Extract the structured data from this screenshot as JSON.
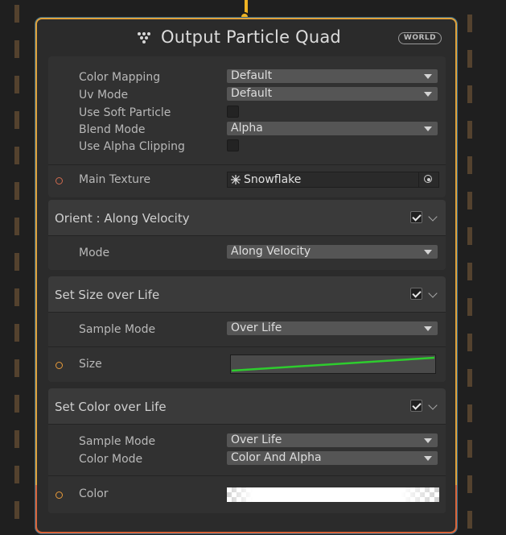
{
  "node": {
    "title": "Output Particle Quad",
    "space_badge": "WORLD"
  },
  "settings": {
    "color_mapping": {
      "label": "Color Mapping",
      "value": "Default"
    },
    "uv_mode": {
      "label": "Uv Mode",
      "value": "Default"
    },
    "use_soft_particle": {
      "label": "Use Soft Particle",
      "checked": false
    },
    "blend_mode": {
      "label": "Blend Mode",
      "value": "Alpha"
    },
    "use_alpha_clipping": {
      "label": "Use Alpha Clipping",
      "checked": false
    },
    "main_texture": {
      "label": "Main Texture",
      "value": "Snowflake",
      "icon": "snowflake-icon"
    }
  },
  "blocks": [
    {
      "title": "Orient : Along Velocity",
      "enabled": true,
      "rows": [
        {
          "label": "Mode",
          "value": "Along Velocity"
        }
      ]
    },
    {
      "title": "Set Size over Life",
      "enabled": true,
      "rows": [
        {
          "label": "Sample Mode",
          "value": "Over Life"
        }
      ],
      "input": {
        "label": "Size",
        "type": "curve",
        "curve_color": "#2ecc2e"
      }
    },
    {
      "title": "Set Color over Life",
      "enabled": true,
      "rows": [
        {
          "label": "Sample Mode",
          "value": "Over Life"
        },
        {
          "label": "Color Mode",
          "value": "Color And Alpha"
        }
      ],
      "input": {
        "label": "Color",
        "type": "gradient"
      }
    }
  ],
  "colors": {
    "node_border": "#e0a13a",
    "flow_link": "#f0b323",
    "port_ring": "#cf6a4e",
    "curve": "#2ecc2e"
  }
}
